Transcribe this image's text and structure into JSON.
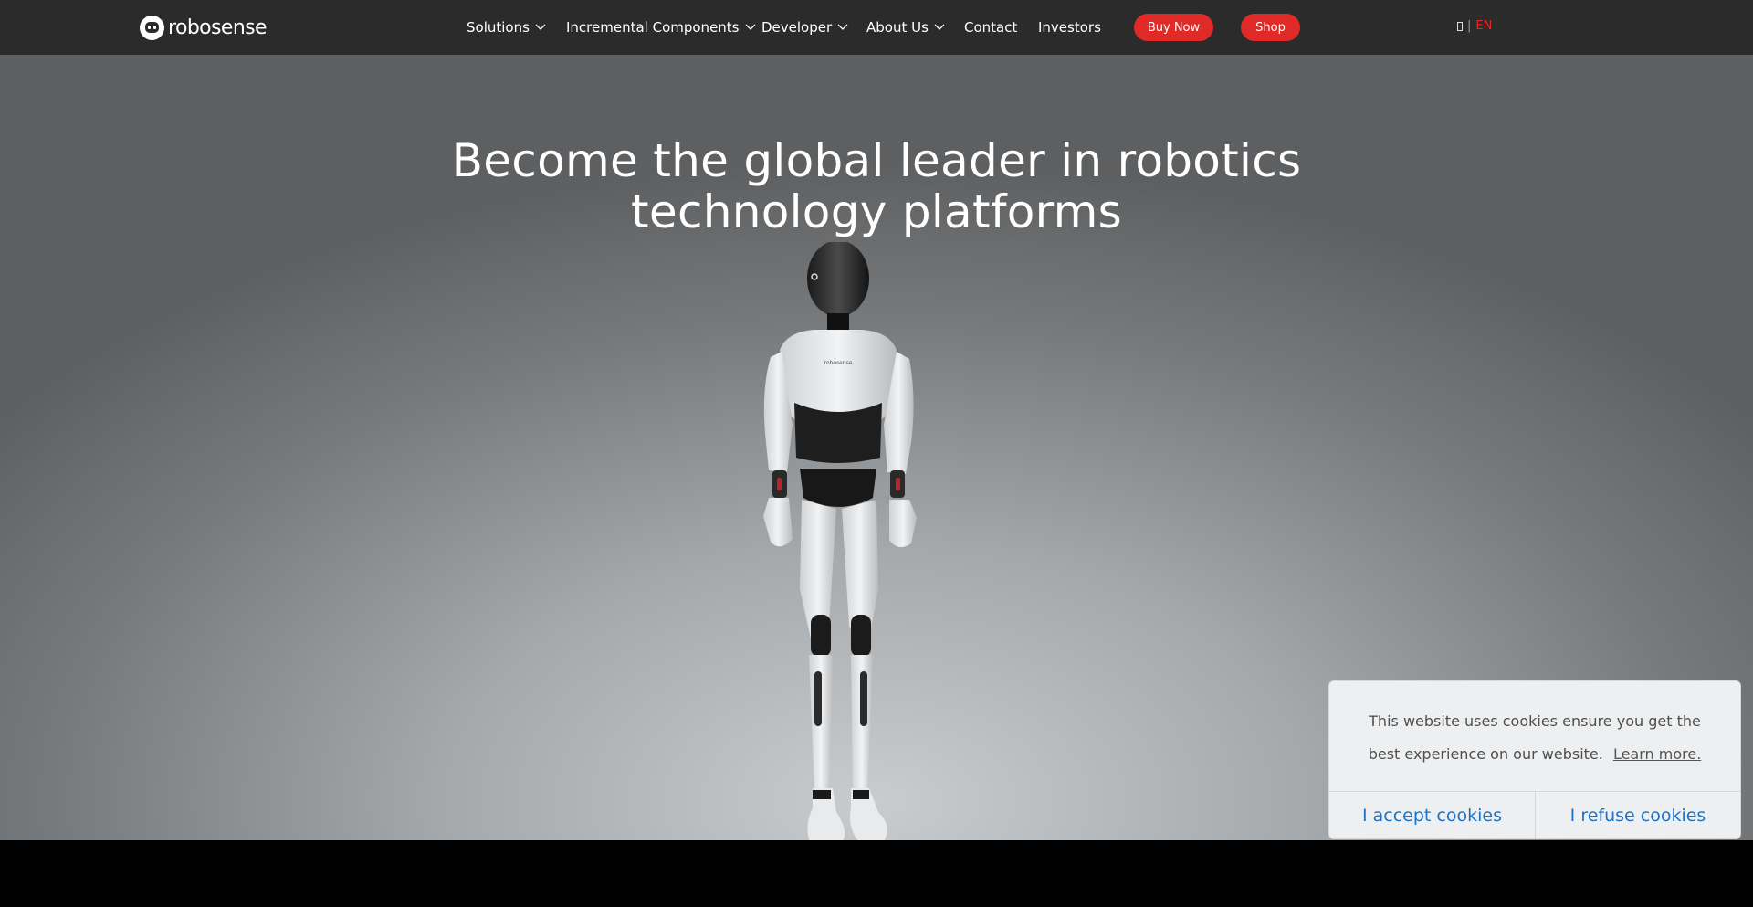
{
  "header": {
    "logo_text": "robosense",
    "nav": [
      {
        "label": "Solutions",
        "has_dropdown": true
      },
      {
        "label": "Incremental Components",
        "has_dropdown": true
      },
      {
        "label": "Developer",
        "has_dropdown": true
      },
      {
        "label": "About Us",
        "has_dropdown": true
      },
      {
        "label": "Contact",
        "has_dropdown": false
      },
      {
        "label": "Investors",
        "has_dropdown": false
      }
    ],
    "buy_now_label": "Buy Now",
    "shop_label": "Shop",
    "language": {
      "separator": "|",
      "current": "EN"
    }
  },
  "hero": {
    "title_line1": "Become the global leader in robotics",
    "title_line2": "technology platforms",
    "robot_chest_logo": "robosense"
  },
  "cookie_banner": {
    "message": "This website uses cookies ensure you get the best experience on our website.",
    "learn_more_label": "Learn more.",
    "accept_label": "I accept cookies",
    "refuse_label": "I refuse cookies"
  },
  "colors": {
    "accent_red": "#e02a27",
    "nav_background": "#2b2b2b",
    "cookie_button_blue": "#1a73c8"
  }
}
